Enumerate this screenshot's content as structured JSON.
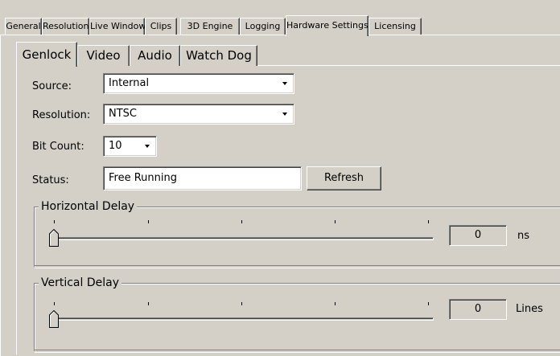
{
  "outer_tabs": [
    {
      "label": "General",
      "active": false
    },
    {
      "label": "Resolution",
      "active": false
    },
    {
      "label": "Live Window",
      "active": false
    },
    {
      "label": "Clips",
      "active": false
    },
    {
      "label": "3D Engine",
      "active": false
    },
    {
      "label": "Logging",
      "active": false
    },
    {
      "label": "Hardware Settings",
      "active": true
    },
    {
      "label": "Licensing",
      "active": false
    }
  ],
  "inner_tabs": [
    {
      "label": "Genlock",
      "active": true
    },
    {
      "label": "Video",
      "active": false
    },
    {
      "label": "Audio",
      "active": false
    },
    {
      "label": "Watch Dog",
      "active": false
    }
  ],
  "form": {
    "source_label": "Source:",
    "source_value": "Internal",
    "resolution_label": "Resolution:",
    "resolution_value": "NTSC",
    "bitcount_label": "Bit Count:",
    "bitcount_value": "10",
    "status_label": "Status:",
    "status_value": "Free Running",
    "refresh_label": "Refresh"
  },
  "horizontal_delay": {
    "title": "Horizontal Delay",
    "value": "0",
    "unit": "ns",
    "slider_position": 0
  },
  "vertical_delay": {
    "title": "Vertical Delay",
    "value": "0",
    "unit": "Lines",
    "slider_position": 0
  }
}
